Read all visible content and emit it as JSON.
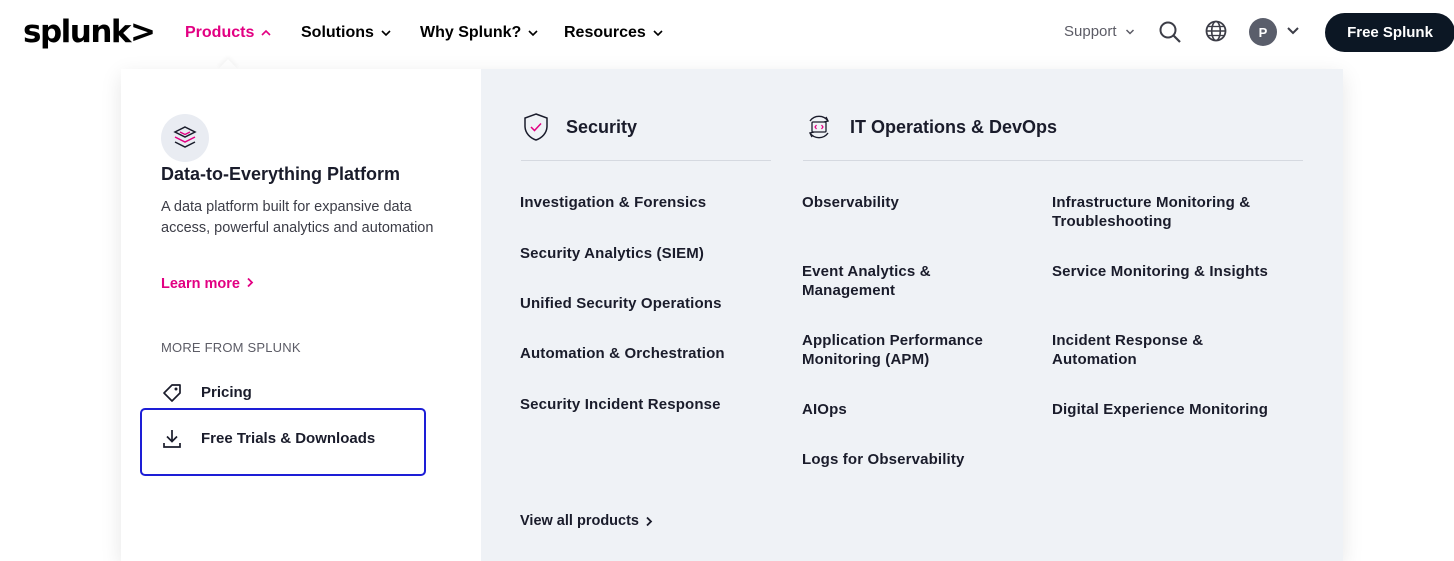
{
  "header": {
    "logo": "splunk>",
    "nav": [
      {
        "label": "Products",
        "active": true
      },
      {
        "label": "Solutions",
        "active": false
      },
      {
        "label": "Why Splunk?",
        "active": false
      },
      {
        "label": "Resources",
        "active": false
      }
    ],
    "support_label": "Support",
    "avatar_initial": "P",
    "cta_label": "Free Splunk"
  },
  "dropdown": {
    "platform": {
      "title": "Data-to-Everything Platform",
      "description": "A data platform built for expansive data access, powerful analytics and automation",
      "learn_more": "Learn more",
      "icon": "layers-icon"
    },
    "more_from_label": "MORE FROM SPLUNK",
    "side_links": [
      {
        "label": "Pricing",
        "icon": "tag-icon"
      },
      {
        "label": "Free Trials & Downloads",
        "icon": "download-icon"
      }
    ],
    "security": {
      "title": "Security",
      "icon": "shield-check-icon",
      "links": [
        "Investigation & Forensics",
        "Security Analytics (SIEM)",
        "Unified Security Operations",
        "Automation & Orchestration",
        "Security Incident Response"
      ]
    },
    "itops": {
      "title": "IT Operations & DevOps",
      "icon": "code-cycle-icon",
      "col1": [
        "Observability",
        "Event Analytics & Management",
        "Application Performance Monitoring (APM)",
        "AIOps",
        "Logs for Observability"
      ],
      "col2": [
        "Infrastructure Monitoring & Troubleshooting",
        "Service Monitoring & Insights",
        "Incident Response & Automation",
        "Digital Experience Monitoring"
      ]
    },
    "view_all": "View all products"
  },
  "colors": {
    "accent": "#e20082",
    "cta_bg": "#0c1724",
    "right_pane_bg": "#eff2f6",
    "highlight": "#1d1ed6"
  }
}
